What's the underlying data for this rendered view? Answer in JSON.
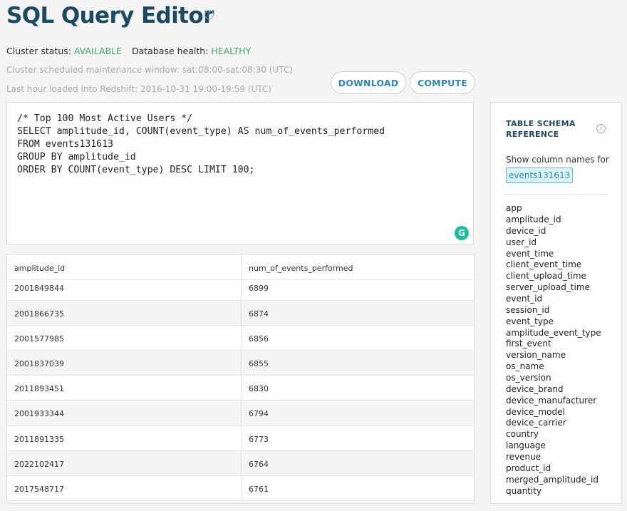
{
  "header": {
    "title": "SQL Query Editor",
    "info_icon": "info-icon",
    "cluster_status_label": "Cluster status:",
    "cluster_status_value": "AVAILABLE",
    "db_health_label": "Database health:",
    "db_health_value": "HEALTHY",
    "maintenance": "Cluster scheduled maintenance window: sat:08:00-sat:08:30 (UTC)",
    "last_loaded": "Last hour loaded into Redshift: 2016-10-31 19:00-19:59 (UTC)"
  },
  "toolbar": {
    "download_label": "DOWNLOAD",
    "compute_label": "COMPUTE"
  },
  "editor": {
    "lines": [
      "/* Top 100 Most Active Users */",
      "SELECT amplitude_id, COUNT(event_type) AS num_of_events_performed",
      "FROM events131613",
      "GROUP BY amplitude_id",
      "ORDER BY COUNT(event_type) DESC LIMIT 100;"
    ],
    "grammarly_icon": "G"
  },
  "results": {
    "columns": [
      "amplitude_id",
      "num_of_events_performed"
    ],
    "rows": [
      [
        "2001849844",
        "6899"
      ],
      [
        "2001866735",
        "6874"
      ],
      [
        "2001577985",
        "6856"
      ],
      [
        "2001837039",
        "6855"
      ],
      [
        "2011893451",
        "6830"
      ],
      [
        "2001933344",
        "6794"
      ],
      [
        "2011891335",
        "6773"
      ],
      [
        "2022102417",
        "6764"
      ],
      [
        "2017548717",
        "6761"
      ]
    ]
  },
  "schema": {
    "title_line1": "TABLE SCHEMA",
    "title_line2": "REFERENCE",
    "show_label": "Show column names for",
    "table_name": "events131613",
    "columns": [
      "app",
      "amplitude_id",
      "device_id",
      "user_id",
      "event_time",
      "client_event_time",
      "client_upload_time",
      "server_upload_time",
      "event_id",
      "session_id",
      "event_type",
      "amplitude_event_type",
      "first_event",
      "version_name",
      "os_name",
      "os_version",
      "device_brand",
      "device_manufacturer",
      "device_model",
      "device_carrier",
      "country",
      "language",
      "revenue",
      "product_id",
      "merged_amplitude_id",
      "quantity"
    ]
  },
  "colors": {
    "title": "#1b4b63",
    "status_ok": "#3cae6b",
    "button_text": "#2a88c0",
    "tag_bg": "#d8f2f7",
    "grammarly": "#15c39a"
  }
}
